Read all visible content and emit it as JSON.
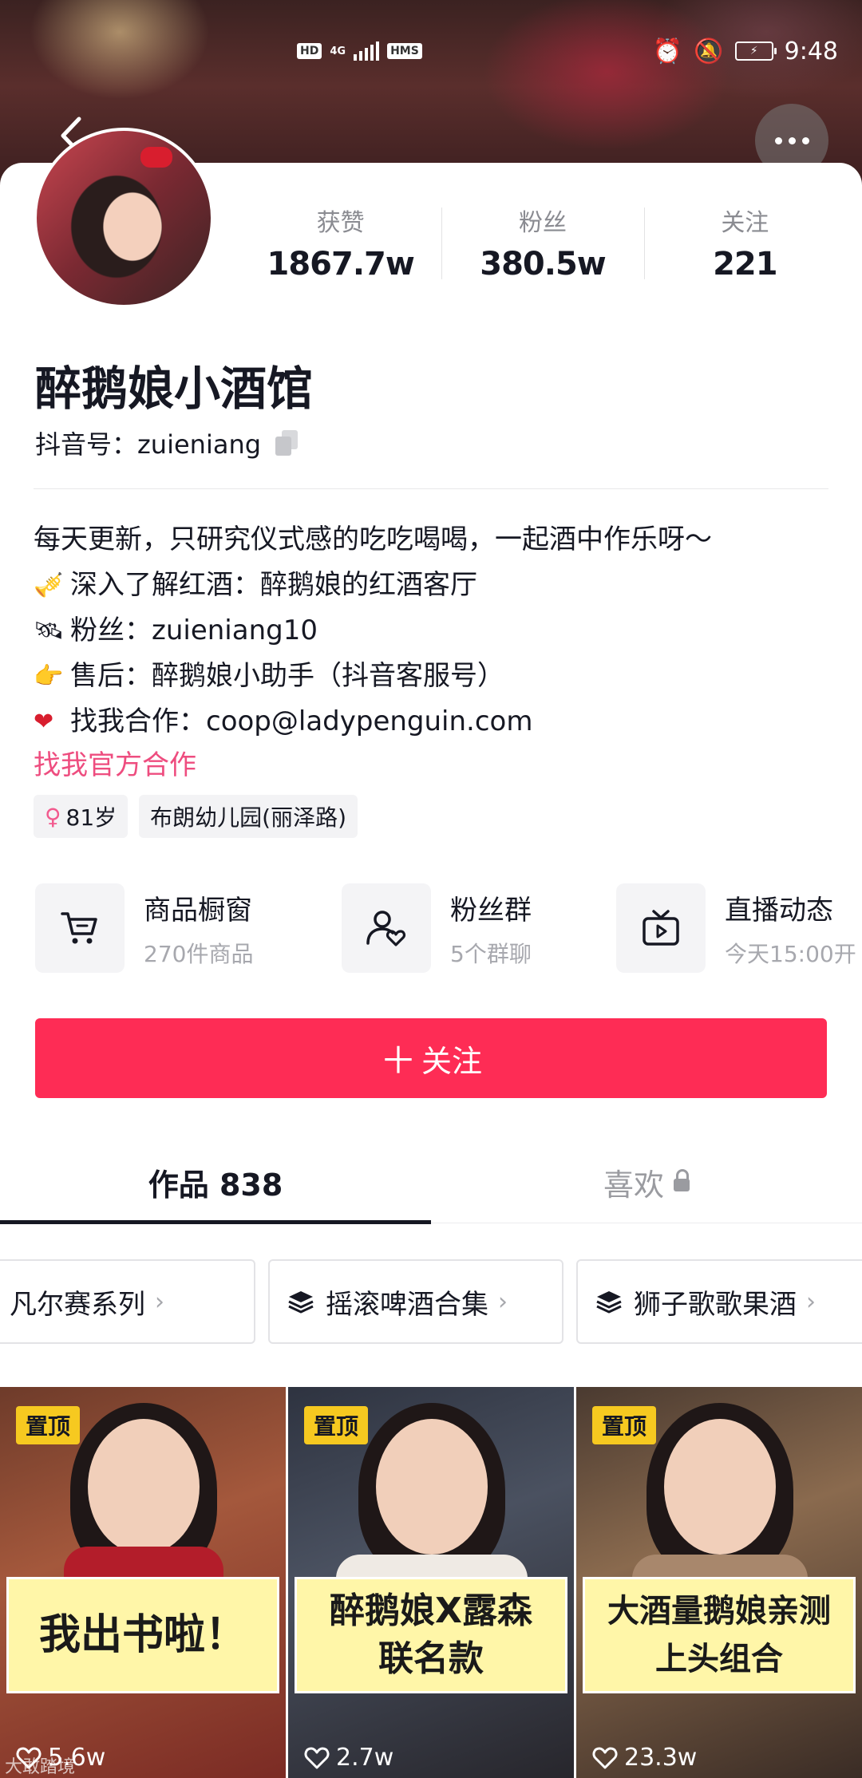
{
  "status_bar": {
    "net_badges": [
      "HD",
      "4G",
      "HMS"
    ],
    "time": "9:48",
    "battery_icon": "battery-charging-icon"
  },
  "profile": {
    "name": "醉鹅娘小酒馆",
    "douyin_id": "抖音号：zuieniang",
    "stats": [
      {
        "label": "获赞",
        "value": "1867.7w"
      },
      {
        "label": "粉丝",
        "value": "380.5w"
      },
      {
        "label": "关注",
        "value": "221"
      }
    ],
    "bio": [
      {
        "emoji": "🎺",
        "text": "每天更新，只研究仪式感的吃吃喝喝，一起酒中作乐呀～"
      },
      {
        "emoji": "🎺",
        "text": "深入了解红酒：醉鹅娘的红酒客厅"
      },
      {
        "emoji": "🛰",
        "text": "粉丝：zuieniang10"
      },
      {
        "emoji": "👉",
        "text": "售后：醉鹅娘小助手（抖音客服号）"
      },
      {
        "emoji": "❤",
        "text": "找我合作：coop@ladypenguin.com"
      }
    ],
    "official_link": "找我官方合作",
    "tags": [
      {
        "icon": "female-icon",
        "text": "81岁"
      },
      {
        "text": "布朗幼儿园(丽泽路)"
      }
    ]
  },
  "services": [
    {
      "icon": "cart-icon",
      "title": "商品橱窗",
      "sub": "270件商品"
    },
    {
      "icon": "fans-group-icon",
      "title": "粉丝群",
      "sub": "5个群聊"
    },
    {
      "icon": "live-tv-icon",
      "title": "直播动态",
      "sub": "今天15:00开"
    }
  ],
  "follow_button": {
    "label": "关注"
  },
  "tabs": [
    {
      "label": "作品 838",
      "active": true
    },
    {
      "label": "喜欢",
      "active": false
    }
  ],
  "collections": [
    "凡尔赛系列",
    "摇滚啤酒合集",
    "狮子歌歌果酒"
  ],
  "videos": [
    {
      "pin": "置顶",
      "caption": "我出书啦！",
      "likes": "5.6w",
      "watermark": "大敢踏境"
    },
    {
      "pin": "置顶",
      "caption": "醉鹅娘X露森\n联名款",
      "likes": "2.7w"
    },
    {
      "pin": "置顶",
      "caption": "大酒量鹅娘亲测\n上头组合",
      "likes": "23.3w"
    }
  ],
  "colors": {
    "accent": "#fe2c55",
    "link": "#ee4d7f",
    "pin": "#f6c920"
  }
}
